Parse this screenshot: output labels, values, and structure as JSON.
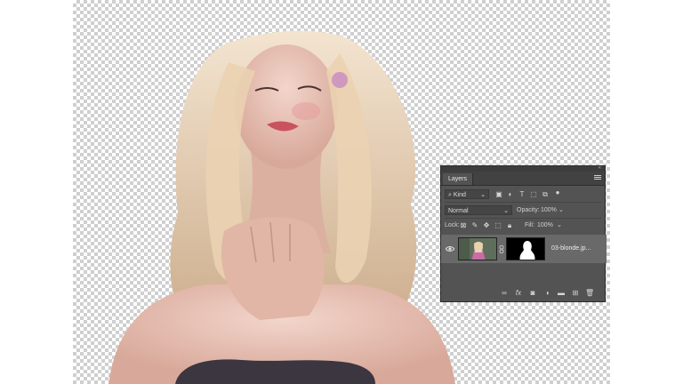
{
  "panel": {
    "tab_label": "Layers",
    "filter": {
      "value": "Kind"
    },
    "blend": {
      "value": "Normal"
    },
    "opacity": {
      "label": "Opacity:",
      "value": "100%"
    },
    "lock": {
      "label": "Lock:"
    },
    "fill": {
      "label": "Fill:",
      "value": "100%"
    },
    "layer": {
      "name": "03-blonde.jp..."
    }
  },
  "colors": {
    "panel_bg": "#535353",
    "selected_layer": "#696969"
  },
  "icons": [
    "search-icon",
    "image-filter-icon",
    "adjustment-filter-icon",
    "type-filter-icon",
    "shape-filter-icon",
    "smart-object-filter-icon",
    "filter-toggle-icon",
    "eye-icon",
    "link-icon",
    "fx-icon",
    "mask-icon",
    "adjustment-icon",
    "folder-icon",
    "new-layer-icon",
    "trash-icon"
  ]
}
